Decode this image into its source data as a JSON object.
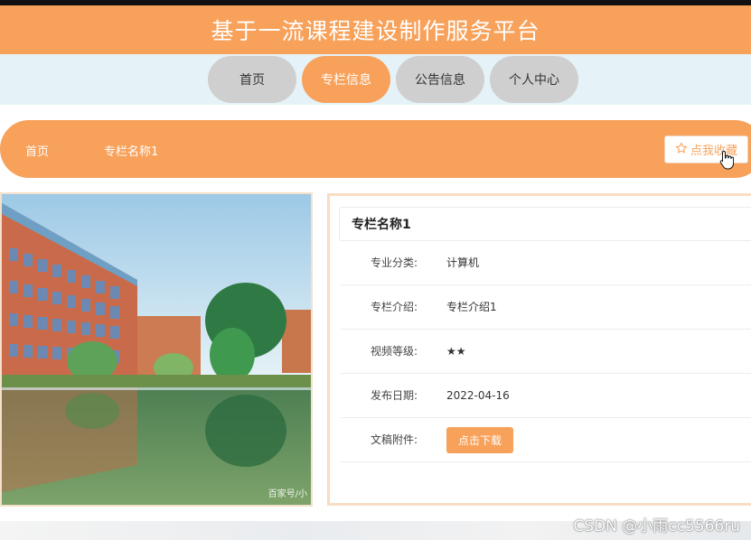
{
  "header": {
    "title": "基于一流课程建设制作服务平台"
  },
  "nav": {
    "items": [
      {
        "label": "首页"
      },
      {
        "label": "专栏信息"
      },
      {
        "label": "公告信息"
      },
      {
        "label": "个人中心"
      }
    ],
    "active_index": 1
  },
  "breadcrumb": {
    "home": "首页",
    "current": "专栏名称1",
    "favorite_label": "点我收藏",
    "favorite_icon": "star-outline-icon"
  },
  "image": {
    "watermark": "百家号/小"
  },
  "detail": {
    "title": "专栏名称1",
    "rows": [
      {
        "label": "专业分类:",
        "value": "计算机"
      },
      {
        "label": "专栏介绍:",
        "value": "专栏介绍1"
      },
      {
        "label": "视频等级:",
        "value": "★★"
      },
      {
        "label": "发布日期:",
        "value": "2022-04-16"
      },
      {
        "label": "文稿附件:",
        "button": "点击下载"
      }
    ]
  },
  "footer": {
    "watermark": "CSDN @小雨cc5566ru"
  },
  "colors": {
    "accent": "#f8a15a",
    "nav_bg": "#e5f2f7",
    "pill_bg": "#cfcfcf"
  }
}
